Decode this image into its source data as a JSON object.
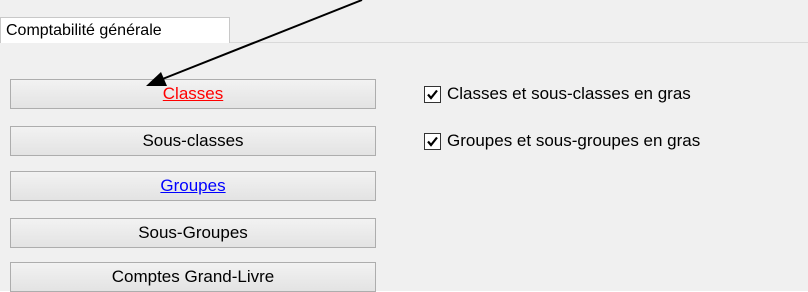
{
  "tabs": [
    {
      "label": "Comptabilité générale",
      "selected": true
    }
  ],
  "buttons": [
    {
      "label": "Classes",
      "color": "#ff0000",
      "highlighted": true
    },
    {
      "label": "Sous-classes",
      "color": "#000000"
    },
    {
      "label": "Groupes",
      "color": "#0000ff",
      "highlighted": true
    },
    {
      "label": "Sous-Groupes",
      "color": "#000000"
    },
    {
      "label": "Comptes Grand-Livre",
      "color": "#000000"
    }
  ],
  "options": [
    {
      "label": "Classes et sous-classes en gras",
      "checked": true
    },
    {
      "label": "Groupes et sous-groupes en gras",
      "checked": true
    }
  ],
  "annotation": {
    "type": "arrow",
    "points_to": "Classes"
  }
}
